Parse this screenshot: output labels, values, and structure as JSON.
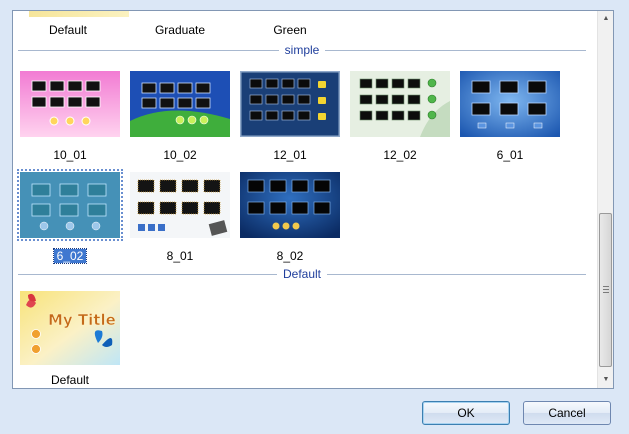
{
  "top_row": {
    "labels": [
      "Default",
      "Graduate",
      "Green"
    ]
  },
  "sections": [
    {
      "title": "simple",
      "items": [
        {
          "label": "10_01",
          "selected": false,
          "icon": "pink-menu-template-thumbnail"
        },
        {
          "label": "10_02",
          "selected": false,
          "icon": "blue-green-menu-template-thumbnail"
        },
        {
          "label": "12_01",
          "selected": false,
          "icon": "dark-blue-menu-template-thumbnail"
        },
        {
          "label": "12_02",
          "selected": false,
          "icon": "light-green-menu-template-thumbnail"
        },
        {
          "label": "6_01",
          "selected": false,
          "icon": "blue-menu-template-thumbnail"
        },
        {
          "label": "6_02",
          "selected": true,
          "icon": "teal-menu-template-thumbnail"
        },
        {
          "label": "8_01",
          "selected": false,
          "icon": "white-film-menu-template-thumbnail"
        },
        {
          "label": "8_02",
          "selected": false,
          "icon": "navy-menu-template-thumbnail"
        }
      ]
    },
    {
      "title": "Default",
      "items": [
        {
          "label": "Default",
          "selected": false,
          "icon": "butterfly-menu-template-thumbnail",
          "thumb_text": "My Title"
        }
      ]
    }
  ],
  "buttons": {
    "ok": "OK",
    "cancel": "Cancel"
  },
  "colors": {
    "section_title": "#1f3e9c",
    "selection": "#3f78d0",
    "dialog_bg": "#dbe7f6"
  }
}
